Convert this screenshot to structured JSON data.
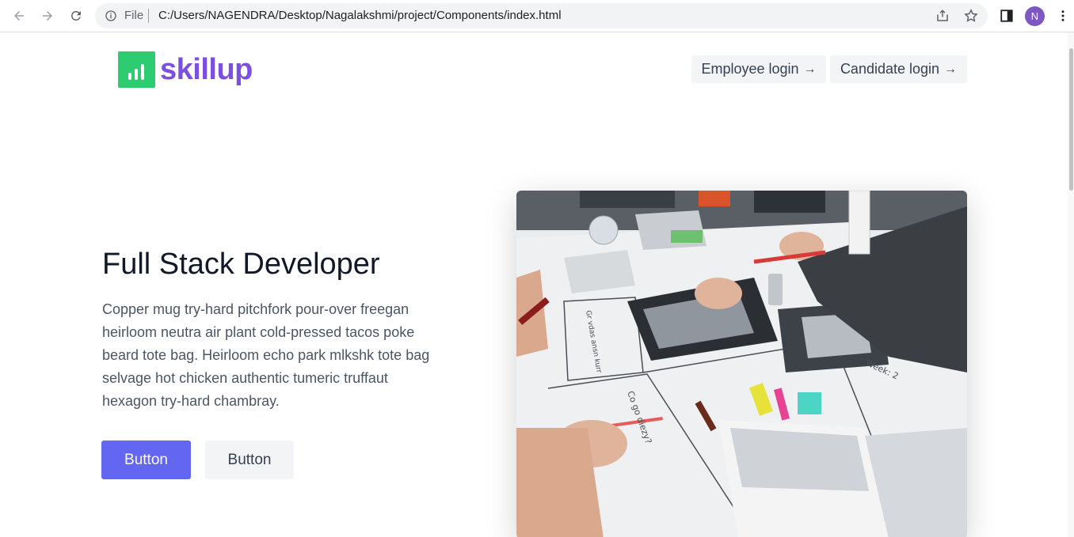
{
  "browser": {
    "omnibox_scheme": "File",
    "url": "C:/Users/NAGENDRA/Desktop/Nagalakshmi/project/Components/index.html",
    "profile_initial": "N",
    "profile_color": "#7e57c2"
  },
  "header": {
    "logo_text": "skillup",
    "logo_color": "#7b4fe0",
    "logo_icon_color": "#2ecc71",
    "buttons": [
      {
        "label": "Employee login",
        "icon": "arrow-right-icon"
      },
      {
        "label": "Candidate login",
        "icon": "arrow-right-icon"
      }
    ]
  },
  "hero": {
    "title": "Full Stack Developer",
    "description": "Copper mug try-hard pitchfork pour-over freegan heirloom neutra air plant cold-pressed tacos poke beard tote bag. Heirloom echo park mlkshk tote bag selvage hot chicken authentic tumeric truffaut hexagon try-hard chambray.",
    "primary_button": "Button",
    "secondary_button": "Button",
    "primary_color": "#6366f1",
    "image_text": {
      "note_1": "Co go diezy?",
      "note_2": "Week: 2",
      "note_3": "Gr vdas ansn kurr"
    }
  }
}
